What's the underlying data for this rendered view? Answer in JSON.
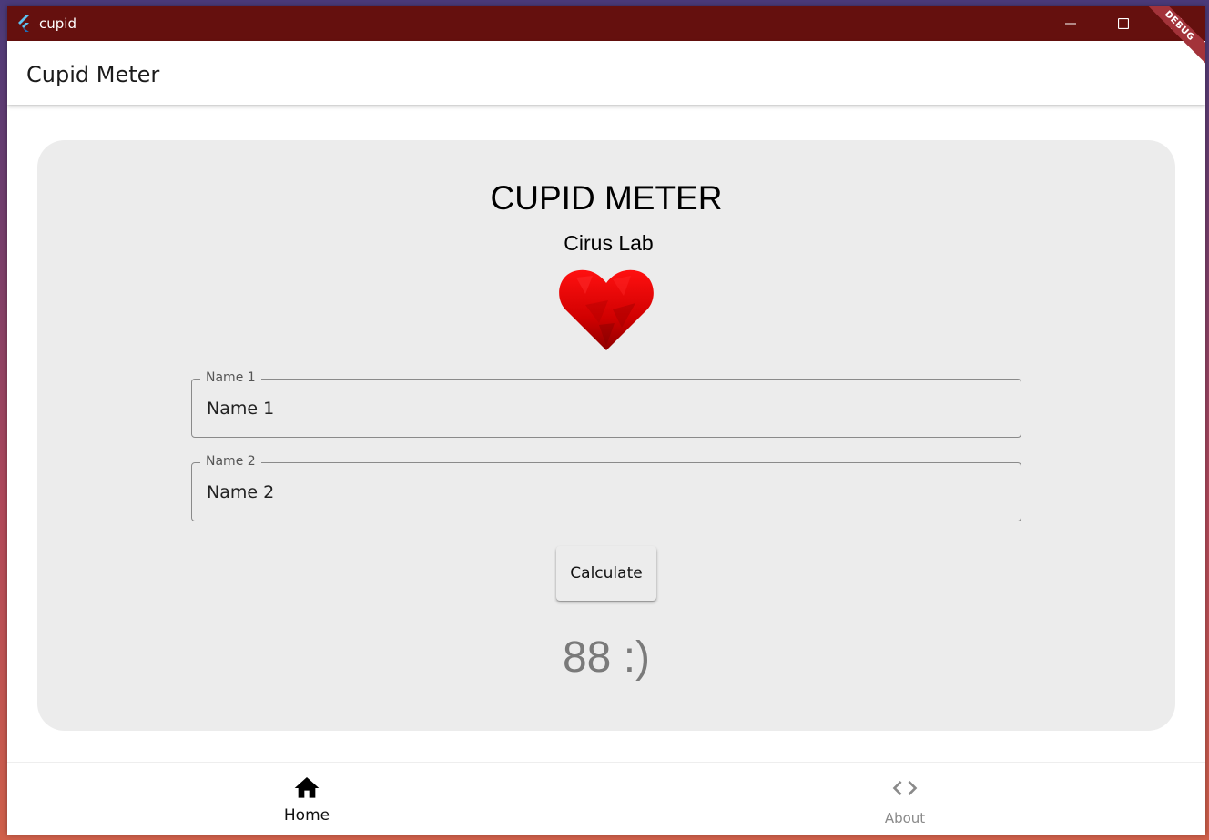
{
  "window": {
    "title": "cupid",
    "titlebar_color": "#65100e",
    "controls": [
      "minimize-icon",
      "maximize-icon",
      "close-icon"
    ]
  },
  "appbar": {
    "title": "Cupid Meter",
    "debug_banner": "DEBUG",
    "debug_banner_color": "#a3333a"
  },
  "card": {
    "title": "CUPID METER",
    "subtitle": "Cirus Lab",
    "heart_icon": "heart-icon",
    "heart_color": "#d40000",
    "name1": {
      "label": "Name 1",
      "placeholder": "Name 1",
      "value": ""
    },
    "name2": {
      "label": "Name 2",
      "placeholder": "Name 2",
      "value": ""
    },
    "calculate_label": "Calculate",
    "result": "88 :)"
  },
  "bottom_nav": {
    "items": [
      {
        "label": "Home",
        "icon": "home-icon",
        "selected": true
      },
      {
        "label": "About",
        "icon": "code-icon",
        "selected": false
      }
    ]
  }
}
